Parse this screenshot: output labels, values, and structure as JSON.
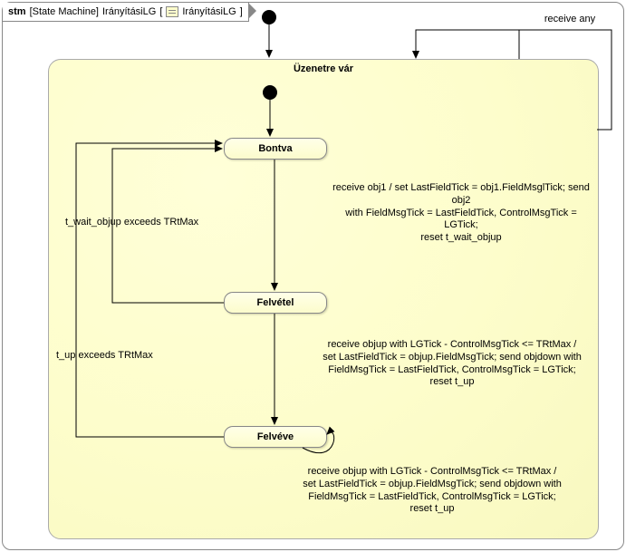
{
  "frame": {
    "stereotype_prefix": "stm",
    "stereotype_bracket": "[State Machine]",
    "name": "IrányításiLG",
    "ref_name": "IrányításiLG"
  },
  "region": {
    "title": "Üzenetre vár"
  },
  "states": {
    "s1": "Bontva",
    "s2": "Felvétel",
    "s3": "Felvéve"
  },
  "transitions": {
    "outer_self": "receive any",
    "t1_label": "receive obj1  / set LastFieldTick = obj1.FieldMsglTick; send obj2\nwith FieldMsgTick = LastFieldTick, ControlMsgTick = LGTick;\nreset t_wait_objup",
    "t2_label": "receive objup with LGTick - ControlMsgTick <= TRtMax /\nset LastFieldTick = objup.FieldMsgTick; send objdown with\nFieldMsgTick = LastFieldTick, ControlMsgTick = LGTick;\nreset t_up",
    "t3_self_label": "receive objup with LGTick - ControlMsgTick <= TRtMax /\nset LastFieldTick = objup.FieldMsgTick; send objdown with\nFieldMsgTick = LastFieldTick, ControlMsgTick = LGTick;\nreset t_up",
    "t_back1": "t_wait_objup exceeds TRtMax",
    "t_back2": "t_up exceeds TRtMax"
  }
}
